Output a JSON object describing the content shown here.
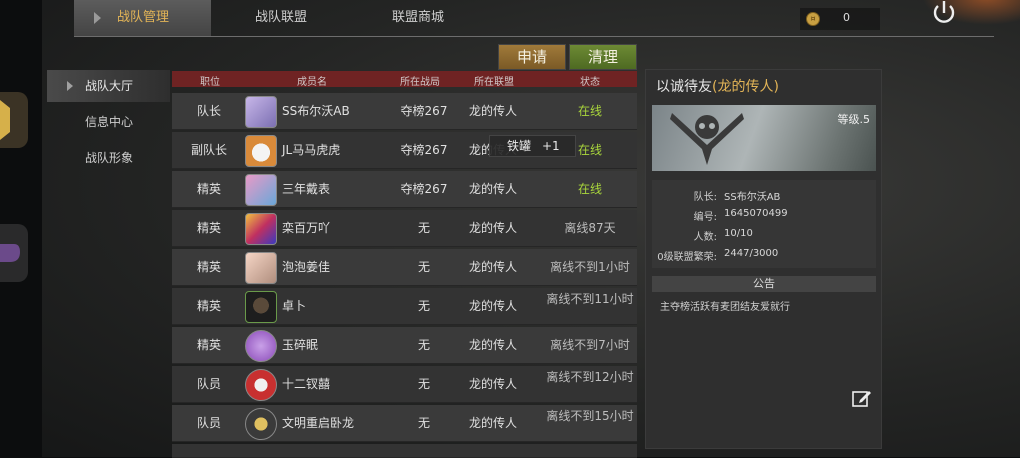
{
  "tabs": [
    "战队管理",
    "战队联盟",
    "联盟商城"
  ],
  "currency": {
    "value": "0",
    "icon": "coin-icon"
  },
  "side_nav": [
    "战队大厅",
    "信息中心",
    "战队形象"
  ],
  "buttons": {
    "apply": "申请",
    "clear": "清理"
  },
  "table": {
    "headers": [
      "职位",
      "成员名",
      "所在战局",
      "所在联盟",
      "状态"
    ],
    "rows": [
      {
        "role": "队长",
        "name": "SS布尔沃AB",
        "battle": "夺榜267",
        "alliance": "龙的传人",
        "status": "在线",
        "online": true
      },
      {
        "role": "副队长",
        "name": "JL马马虎虎",
        "battle": "夺榜267",
        "alliance": "龙的传人",
        "status": "在线",
        "online": true
      },
      {
        "role": "精英",
        "name": "三年戴表",
        "battle": "夺榜267",
        "alliance": "龙的传人",
        "status": "在线",
        "online": true
      },
      {
        "role": "精英",
        "name": "栾百万吖",
        "battle": "无",
        "alliance": "龙的传人",
        "status": "离线87天",
        "online": false
      },
      {
        "role": "精英",
        "name": "泡泡姜佳",
        "battle": "无",
        "alliance": "龙的传人",
        "status": "离线不到1小时",
        "online": false
      },
      {
        "role": "精英",
        "name": "卓卜",
        "battle": "无",
        "alliance": "龙的传人",
        "status": "离线不到11小时",
        "online": false
      },
      {
        "role": "精英",
        "name": "玉碎眠",
        "battle": "无",
        "alliance": "龙的传人",
        "status": "离线不到7小时",
        "online": false
      },
      {
        "role": "队员",
        "name": "十二钗囍",
        "battle": "无",
        "alliance": "龙的传人",
        "status": "离线不到12小时",
        "online": false
      },
      {
        "role": "队员",
        "name": "文明重启卧龙",
        "battle": "无",
        "alliance": "龙的传人",
        "status": "离线不到15小时",
        "online": false
      }
    ]
  },
  "tooltip": {
    "item": "铁罐",
    "amount": "+1"
  },
  "panel": {
    "title_prefix": "以诚待友",
    "title_highlight": "(龙的传人)",
    "level": "等级.5",
    "info": [
      {
        "key": "队长:",
        "value": "SS布尔沃AB"
      },
      {
        "key": "编号:",
        "value": "1645070499"
      },
      {
        "key": "人数:",
        "value": "10/10"
      },
      {
        "key": "0级联盟繁荣:",
        "value": "2447/3000"
      }
    ],
    "notice_header": "公告",
    "notice": "主夺榜活跃有麦团结友爱就行"
  },
  "colors": {
    "accent": "#e2b457",
    "online": "#a9d63c",
    "header_red": "#6f2323"
  }
}
